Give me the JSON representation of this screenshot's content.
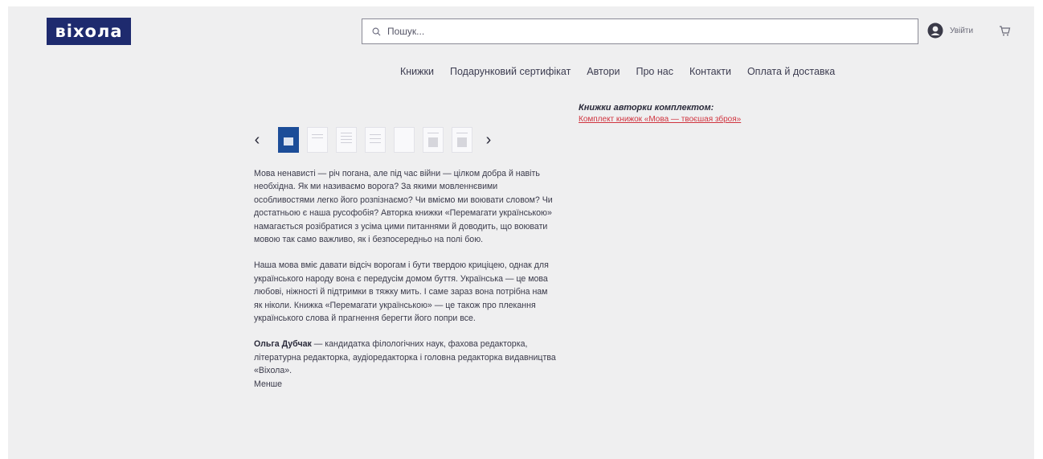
{
  "header": {
    "logo": "віхола",
    "search": {
      "placeholder": "Пошук..."
    },
    "login_label": "Увійти"
  },
  "nav": {
    "items": [
      "Книжки",
      "Подарунковий сертифікат",
      "Автори",
      "Про нас",
      "Контакти",
      "Оплата й доставка"
    ]
  },
  "sidebar": {
    "title": "Книжки авторки комплектом:",
    "link": "Комплект книжок «Мова — твоєшая зброя»"
  },
  "gallery": {
    "prev": "‹",
    "next": "›",
    "thumb_count": 7
  },
  "description": {
    "p1": "Мова ненависті — річ погана, але під час війни — цілком добра й навіть необхідна. Як ми називаємо ворога? За якими мовленнєвими особливостями легко його розпізнаємо? Чи вміємо ми воювати словом? Чи достатньою є наша русофобія? Авторка книжки «Перемагати українською» намагається розібратися з усіма цими питаннями й доводить, що воювати мовою так само важливо, як і безпосередньо на полі бою.",
    "p2": "Наша мова вміє давати відсіч ворогам і бути твердою криціцею, однак для українського народу вона є передусім домом буття. Українська — це мова любові, ніжності й підтримки в тяжку мить. І саме зараз вона потрібна нам як ніколи. Книжка «Перемагати українською» — це також про плекання українського слова й прагнення берегти його попри все.",
    "author_name": "Ольга Дубчак",
    "author_bio": " — кандидатка філологічних наук, фахова редакторка, літературна редакторка, аудіоредакторка і головна редакторка видавництва «Віхола».",
    "more": "Менше"
  },
  "colors": {
    "logo_bg": "#1e2a6e",
    "page_bg": "#efeff0",
    "link_red": "#d0343f",
    "active_thumb": "#1c4d98"
  }
}
